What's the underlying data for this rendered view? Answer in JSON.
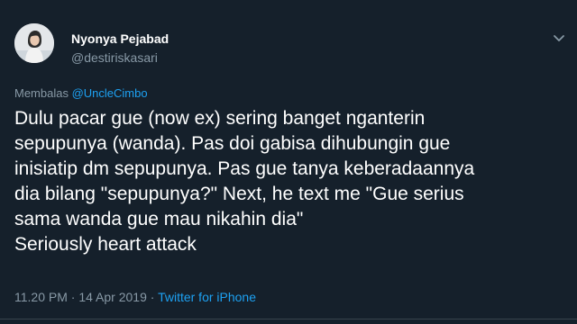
{
  "author": {
    "display_name": "Nyonya Pejabad",
    "handle": "@destiriskasari",
    "avatar_icon": "profile-photo"
  },
  "reply": {
    "prefix": "Membalas",
    "mention": "@UncleCimbo"
  },
  "tweet": {
    "lines": [
      "Dulu pacar gue (now ex) sering banget nganterin",
      "sepupunya (wanda). Pas doi gabisa dihubungin gue",
      "inisiatip dm sepupunya. Pas gue tanya keberadaannya",
      "dia bilang \"sepupunya?\" Next, he text me \"Gue serius",
      "sama wanda gue mau nikahin dia\"",
      "Seriously heart attack"
    ]
  },
  "meta": {
    "time": "11.20 PM",
    "separator1": " · ",
    "date": "14 Apr 2019",
    "separator2": " · ",
    "source": "Twitter for iPhone"
  },
  "menu": {
    "icon": "chevron-down-icon"
  },
  "colors": {
    "background": "#15202b",
    "text": "#ffffff",
    "secondary": "#8899a6",
    "link": "#1da1f2"
  }
}
